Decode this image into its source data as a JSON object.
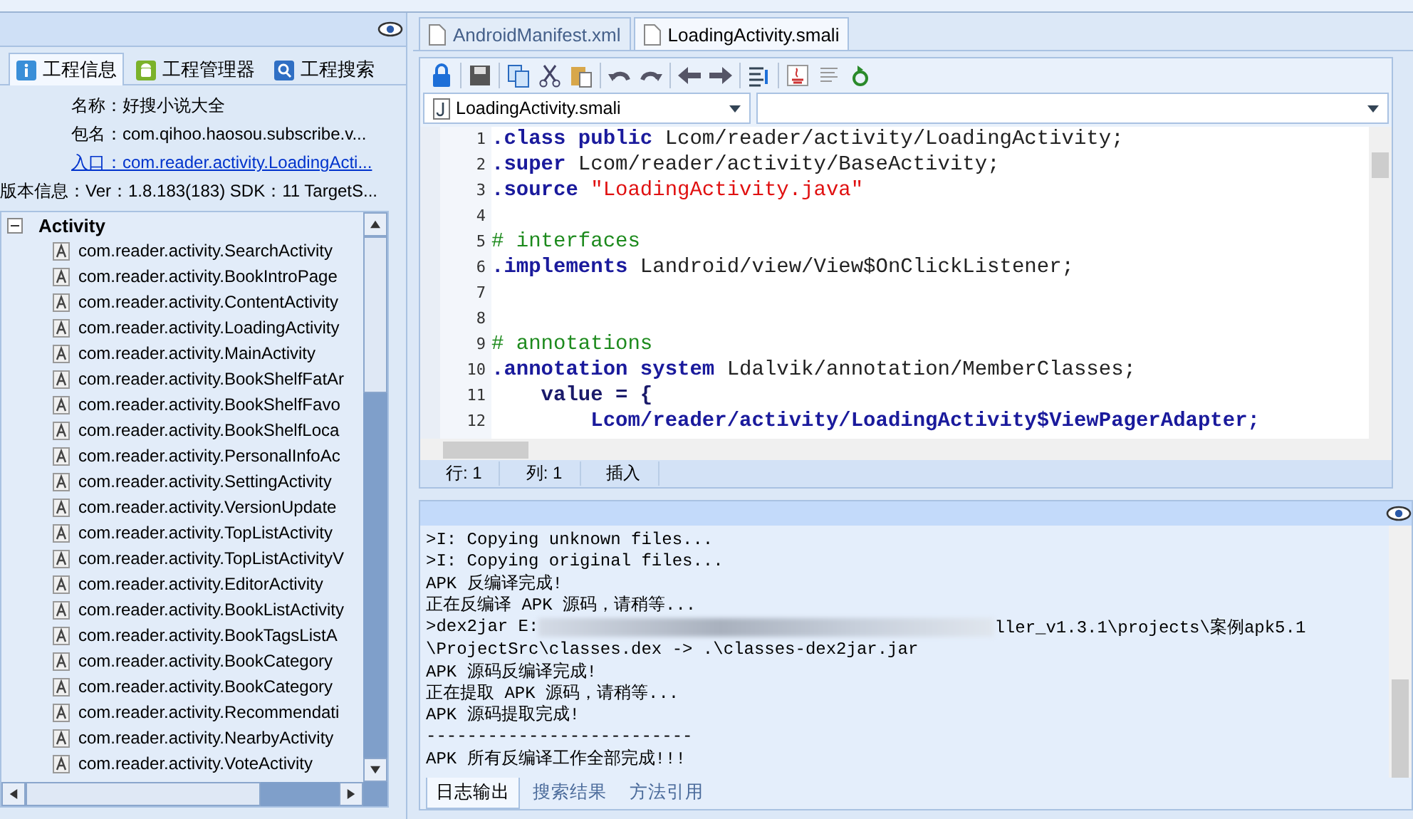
{
  "left_panel": {
    "tabs": [
      {
        "label": "工程信息",
        "kind": "info",
        "selected": true
      },
      {
        "label": "工程管理器",
        "kind": "android",
        "selected": false
      },
      {
        "label": "工程搜索",
        "kind": "search",
        "selected": false
      }
    ],
    "info": [
      {
        "label": "名称：",
        "value": "好搜小说大全",
        "link": false
      },
      {
        "label": "包名：",
        "value": "com.qihoo.haosou.subscribe.v...",
        "link": false
      },
      {
        "label": "入口：",
        "value": "com.reader.activity.LoadingActi...",
        "link": true
      },
      {
        "label": "版本信息：",
        "value": "Ver：1.8.183(183) SDK：11 TargetS...",
        "link": false
      }
    ],
    "tree": {
      "label": "Activity",
      "expanded": true,
      "children": [
        "com.reader.activity.SearchActivity",
        "com.reader.activity.BookIntroPage",
        "com.reader.activity.ContentActivity",
        "com.reader.activity.LoadingActivity",
        "com.reader.activity.MainActivity",
        "com.reader.activity.BookShelfFatAr",
        "com.reader.activity.BookShelfFavo",
        "com.reader.activity.BookShelfLoca",
        "com.reader.activity.PersonalInfoAc",
        "com.reader.activity.SettingActivity",
        "com.reader.activity.VersionUpdate",
        "com.reader.activity.TopListActivity",
        "com.reader.activity.TopListActivityV",
        "com.reader.activity.EditorActivity",
        "com.reader.activity.BookListActivity",
        "com.reader.activity.BookTagsListA",
        "com.reader.activity.BookCategory",
        "com.reader.activity.BookCategory",
        "com.reader.activity.Recommendati",
        "com.reader.activity.NearbyActivity",
        "com.reader.activity.VoteActivity"
      ]
    }
  },
  "editor": {
    "tabs": [
      {
        "label": "AndroidManifest.xml",
        "selected": false
      },
      {
        "label": "LoadingActivity.smali",
        "selected": true
      }
    ],
    "file_select": "LoadingActivity.smali",
    "lines": [
      {
        "number": "1",
        "tokens": [
          {
            "kind": "keyword",
            "text": ".class public"
          },
          {
            "kind": "plain",
            "text": " Lcom/reader/activity/LoadingActivity;"
          }
        ]
      },
      {
        "number": "2",
        "tokens": [
          {
            "kind": "keyword",
            "text": ".super"
          },
          {
            "kind": "plain",
            "text": " Lcom/reader/activity/BaseActivity;"
          }
        ]
      },
      {
        "number": "3",
        "tokens": [
          {
            "kind": "keyword",
            "text": ".source"
          },
          {
            "kind": "string",
            "text": " \"LoadingActivity.java\""
          }
        ]
      },
      {
        "number": "4"
      },
      {
        "number": "5",
        "tokens": [
          {
            "kind": "comment",
            "text": "# interfaces"
          }
        ]
      },
      {
        "number": "6",
        "tokens": [
          {
            "kind": "keyword",
            "text": ".implements"
          },
          {
            "kind": "plain",
            "text": " Landroid/view/View$OnClickListener;"
          }
        ]
      },
      {
        "number": "7"
      },
      {
        "number": "8"
      },
      {
        "number": "9",
        "tokens": [
          {
            "kind": "comment",
            "text": "# annotations"
          }
        ]
      },
      {
        "number": "10",
        "tokens": [
          {
            "kind": "keyword",
            "text": ".annotation system"
          },
          {
            "kind": "plain",
            "text": " Ldalvik/annotation/MemberClasses;"
          }
        ]
      },
      {
        "number": "11",
        "tokens": [
          {
            "kind": "bold",
            "text": "    value = {"
          }
        ]
      },
      {
        "number": "12",
        "tokens": [
          {
            "kind": "type",
            "text": "        Lcom/reader/activity/LoadingActivity$ViewPagerAdapter;"
          }
        ]
      }
    ],
    "status": [
      {
        "text": "行: 1"
      },
      {
        "text": "列: 1"
      },
      {
        "text": "插入"
      }
    ]
  },
  "log": {
    "lines": [
      {
        "parts": [
          ">I: Copying unknown files..."
        ]
      },
      {
        "parts": [
          ">I: Copying original files..."
        ]
      },
      {
        "parts": [
          "APK 反编译完成!"
        ]
      },
      {
        "parts": [
          "正在反编译 APK 源码，请稍等..."
        ]
      },
      {
        "parts": [
          ">dex2jar E:",
          "ller_v1.3.1\\projects\\案例apk5.1"
        ]
      },
      {
        "parts": [
          "\\ProjectSrc\\classes.dex -> .\\classes-dex2jar.jar"
        ]
      },
      {
        "parts": [
          "APK 源码反编译完成!"
        ]
      },
      {
        "parts": [
          "正在提取 APK 源码，请稍等..."
        ]
      },
      {
        "parts": [
          "APK 源码提取完成!"
        ]
      },
      {
        "parts": [
          "--------------------------"
        ]
      },
      {
        "parts": [
          "APK 所有反编译工作全部完成!!!"
        ]
      }
    ],
    "tabs": [
      {
        "label": "日志输出",
        "selected": true
      },
      {
        "label": "搜索结果",
        "selected": false
      },
      {
        "label": "方法引用",
        "selected": false
      }
    ]
  }
}
